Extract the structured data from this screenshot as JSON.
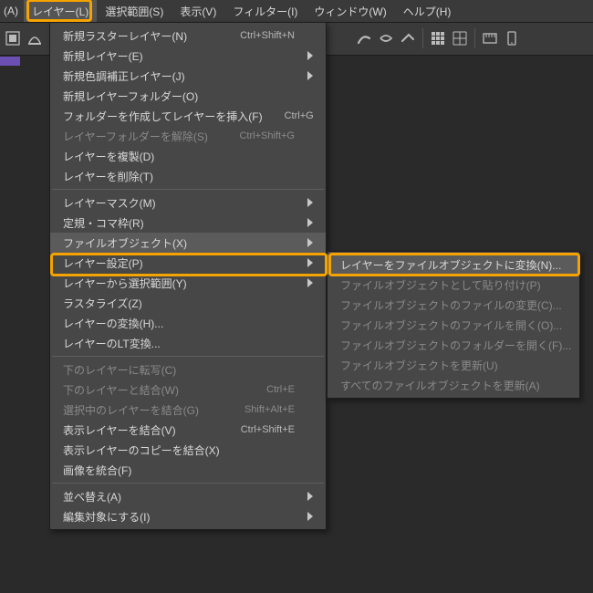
{
  "menubar": {
    "items": [
      {
        "label": "(A)"
      },
      {
        "label": "レイヤー(L)"
      },
      {
        "label": "選択範囲(S)"
      },
      {
        "label": "表示(V)"
      },
      {
        "label": "フィルター(I)"
      },
      {
        "label": "ウィンドウ(W)"
      },
      {
        "label": "ヘルプ(H)"
      }
    ]
  },
  "main_menu": {
    "rows": [
      {
        "label": "新規ラスターレイヤー(N)",
        "shortcut": "Ctrl+Shift+N",
        "enabled": true
      },
      {
        "label": "新規レイヤー(E)",
        "submenu": true,
        "enabled": true
      },
      {
        "label": "新規色調補正レイヤー(J)",
        "submenu": true,
        "enabled": true
      },
      {
        "label": "新規レイヤーフォルダー(O)",
        "enabled": true
      },
      {
        "label": "フォルダーを作成してレイヤーを挿入(F)",
        "shortcut": "Ctrl+G",
        "enabled": true
      },
      {
        "label": "レイヤーフォルダーを解除(S)",
        "shortcut": "Ctrl+Shift+G",
        "enabled": false
      },
      {
        "label": "レイヤーを複製(D)",
        "enabled": true
      },
      {
        "label": "レイヤーを削除(T)",
        "enabled": true
      },
      {
        "sep": true
      },
      {
        "label": "レイヤーマスク(M)",
        "submenu": true,
        "enabled": true
      },
      {
        "label": "定規・コマ枠(R)",
        "submenu": true,
        "enabled": true
      },
      {
        "label": "ファイルオブジェクト(X)",
        "submenu": true,
        "enabled": true,
        "hover": true
      },
      {
        "label": "レイヤー設定(P)",
        "submenu": true,
        "enabled": true
      },
      {
        "label": "レイヤーから選択範囲(Y)",
        "submenu": true,
        "enabled": true
      },
      {
        "label": "ラスタライズ(Z)",
        "enabled": true
      },
      {
        "label": "レイヤーの変換(H)...",
        "enabled": true
      },
      {
        "label": "レイヤーのLT変換...",
        "enabled": true
      },
      {
        "sep": true
      },
      {
        "label": "下のレイヤーに転写(C)",
        "enabled": false
      },
      {
        "label": "下のレイヤーと結合(W)",
        "shortcut": "Ctrl+E",
        "enabled": false
      },
      {
        "label": "選択中のレイヤーを結合(G)",
        "shortcut": "Shift+Alt+E",
        "enabled": false
      },
      {
        "label": "表示レイヤーを結合(V)",
        "shortcut": "Ctrl+Shift+E",
        "enabled": true
      },
      {
        "label": "表示レイヤーのコピーを結合(X)",
        "enabled": true
      },
      {
        "label": "画像を統合(F)",
        "enabled": true
      },
      {
        "sep": true
      },
      {
        "label": "並べ替え(A)",
        "submenu": true,
        "enabled": true
      },
      {
        "label": "編集対象にする(I)",
        "submenu": true,
        "enabled": true
      }
    ]
  },
  "sub_menu": {
    "rows": [
      {
        "label": "レイヤーをファイルオブジェクトに変換(N)...",
        "enabled": true,
        "hover": true
      },
      {
        "label": "ファイルオブジェクトとして貼り付け(P)",
        "enabled": false
      },
      {
        "label": "ファイルオブジェクトのファイルの変更(C)...",
        "enabled": false
      },
      {
        "label": "ファイルオブジェクトのファイルを開く(O)...",
        "enabled": false
      },
      {
        "label": "ファイルオブジェクトのフォルダーを開く(F)...",
        "enabled": false
      },
      {
        "label": "ファイルオブジェクトを更新(U)",
        "enabled": false
      },
      {
        "label": "すべてのファイルオブジェクトを更新(A)",
        "enabled": false
      }
    ]
  }
}
